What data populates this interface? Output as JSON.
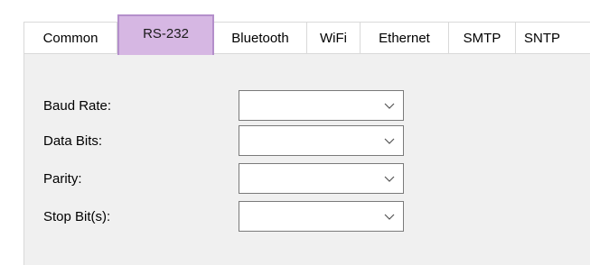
{
  "tabs": [
    {
      "label": "Common",
      "active": false
    },
    {
      "label": "RS-232",
      "active": true
    },
    {
      "label": "Bluetooth",
      "active": false
    },
    {
      "label": "WiFi",
      "active": false
    },
    {
      "label": "Ethernet",
      "active": false
    },
    {
      "label": "SMTP",
      "active": false
    },
    {
      "label": "SNTP",
      "active": false
    }
  ],
  "fields": [
    {
      "label": "Baud Rate:",
      "value": ""
    },
    {
      "label": "Data Bits:",
      "value": ""
    },
    {
      "label": "Parity:",
      "value": ""
    },
    {
      "label": "Stop Bit(s):",
      "value": ""
    }
  ],
  "icons": {
    "dropdown": "chevron-down-icon"
  },
  "colors": {
    "active_tab_bg": "#d6b7e3",
    "active_tab_border": "#b48fcb",
    "panel_bg": "#f0f0f0",
    "border": "#d9d9d9"
  }
}
